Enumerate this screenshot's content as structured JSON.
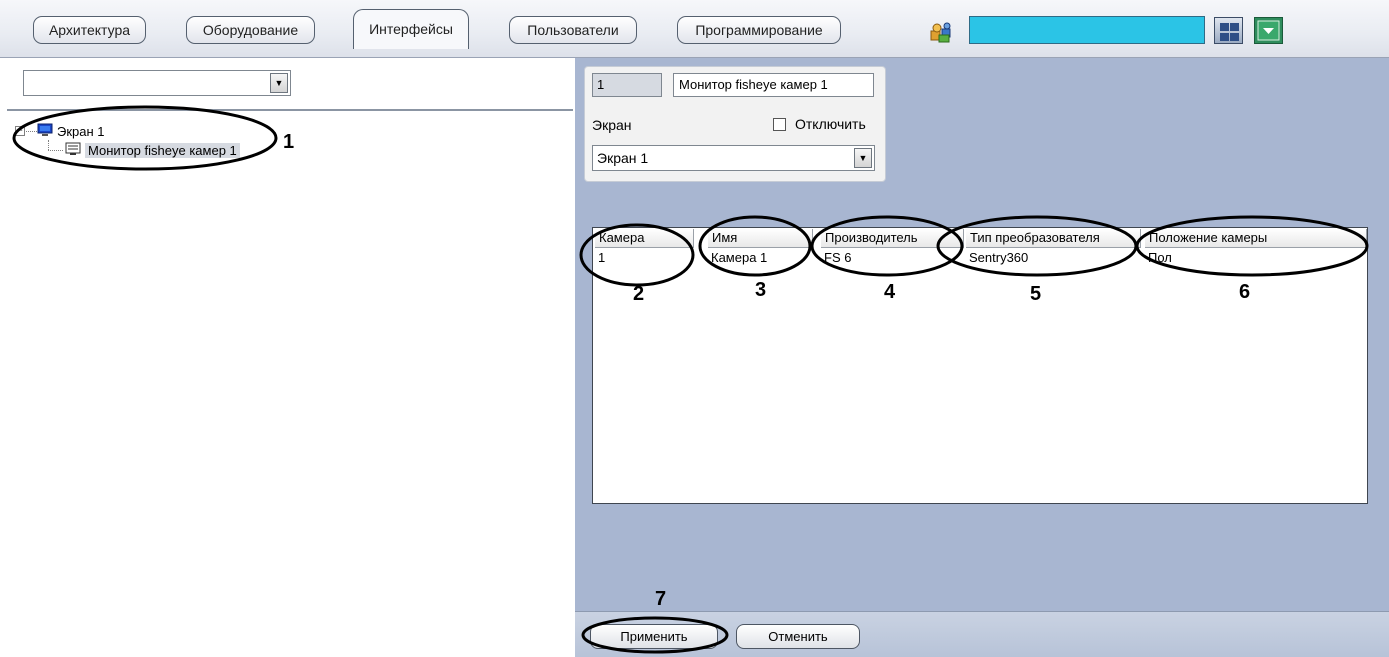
{
  "tabs": [
    {
      "label": "Архитектура"
    },
    {
      "label": "Оборудование"
    },
    {
      "label": "Интерфейсы",
      "active": true
    },
    {
      "label": "Пользователи"
    },
    {
      "label": "Программирование"
    }
  ],
  "toolbar": {
    "search_color": "#2bc4e6",
    "icons": [
      "user-group-icon",
      "layout-grid-icon",
      "dropdown-menu-icon"
    ]
  },
  "left": {
    "combo_value": "",
    "tree": {
      "root_label": "Экран 1",
      "child_label": "Монитор fisheye камер 1"
    },
    "callout": "1"
  },
  "props": {
    "id_value": "1",
    "name_value": "Монитор fisheye камер 1",
    "screen_label": "Экран",
    "disable_label": "Отключить",
    "disable_checked": false,
    "screen_combo_value": "Экран 1"
  },
  "table": {
    "columns": [
      "Камера",
      "Имя",
      "Производитель",
      "Тип преобразователя",
      "Положение камеры"
    ],
    "rows": [
      [
        "1",
        "Камера 1",
        "FS 6",
        "Sentry360",
        "Пол"
      ]
    ],
    "callouts": [
      "2",
      "3",
      "4",
      "5",
      "6"
    ]
  },
  "footer": {
    "apply_label": "Применить",
    "cancel_label": "Отменить",
    "callout": "7"
  },
  "colors": {
    "panel_bg": "#a8b6d1",
    "selection": "#d6dae1",
    "search_field": "#2bc4e6"
  }
}
